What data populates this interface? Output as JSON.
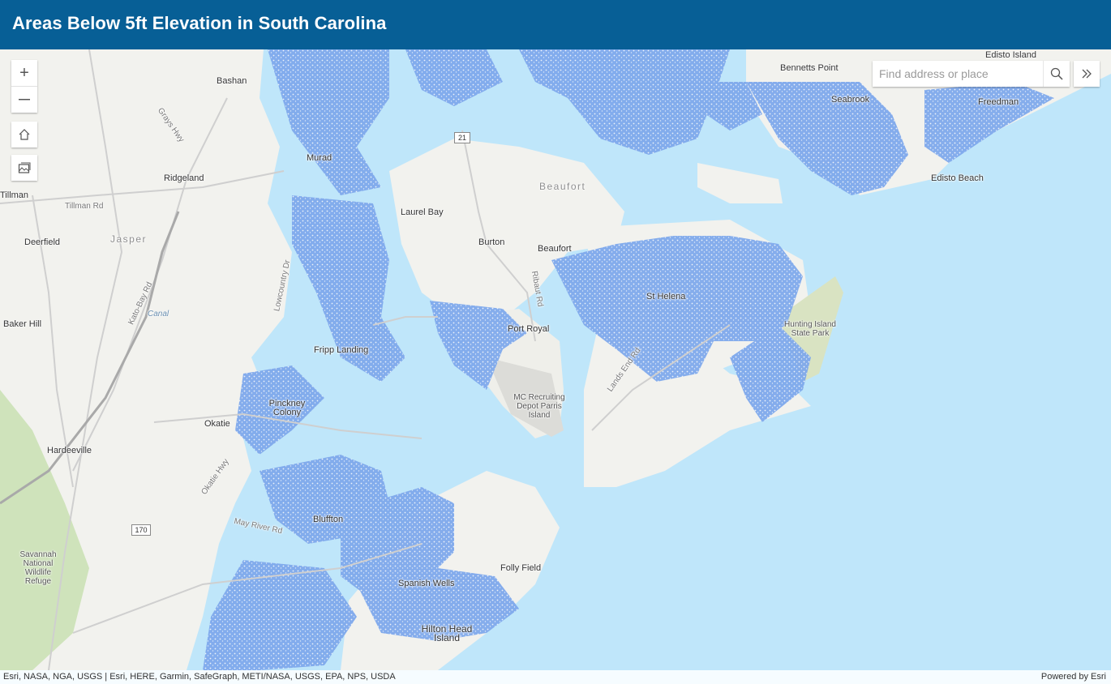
{
  "header": {
    "title": "Areas Below 5ft Elevation in South Carolina"
  },
  "controls": {
    "zoom_in_symbol": "+",
    "zoom_out_symbol": "—",
    "home_icon": "home-icon",
    "basemap_icon": "basemap-gallery-icon"
  },
  "search": {
    "placeholder": "Find address or place",
    "icon": "search-icon"
  },
  "expand": {
    "symbol": "»",
    "icon": "double-chevron-right-icon"
  },
  "map": {
    "places": [
      "Bashan",
      "Murad",
      "Ridgeland",
      "Tillman",
      "Laurel Bay",
      "Beaufort",
      "Burton",
      "Beaufort",
      "Deerfield",
      "Jasper",
      "St Helena",
      "Port Royal",
      "Baker Hill",
      "Fripp Landing",
      "Hunting Island State Park",
      "MC Recruiting Depot Parris Island",
      "Pinckney Colony",
      "Okatie",
      "Hardeeville",
      "Bluffton",
      "Savannah National Wildlife Refuge",
      "Folly Field",
      "Spanish Wells",
      "Hilton Head Island",
      "Bennetts Point",
      "Seabrook",
      "Edisto Island",
      "Freedman",
      "Edisto Beach"
    ],
    "roads": [
      "Grays Hwy",
      "Tillman Rd",
      "Lowcountry Dr",
      "Kato-Bay Rd",
      "Okatie Hwy",
      "May River Rd",
      "Ribaut Rd",
      "Lands End Rd"
    ],
    "shields": [
      "21",
      "170"
    ],
    "water": [
      "Canal"
    ],
    "colors": {
      "water": "#bfe6fa",
      "land": "#f2f2ee",
      "low_elevation": "#6f9fe8",
      "header": "#075f96"
    }
  },
  "attribution": {
    "sources": "Esri, NASA, NGA, USGS | Esri, HERE, Garmin, SafeGraph, METI/NASA, USGS, EPA, NPS, USDA",
    "powered": "Powered by Esri"
  }
}
